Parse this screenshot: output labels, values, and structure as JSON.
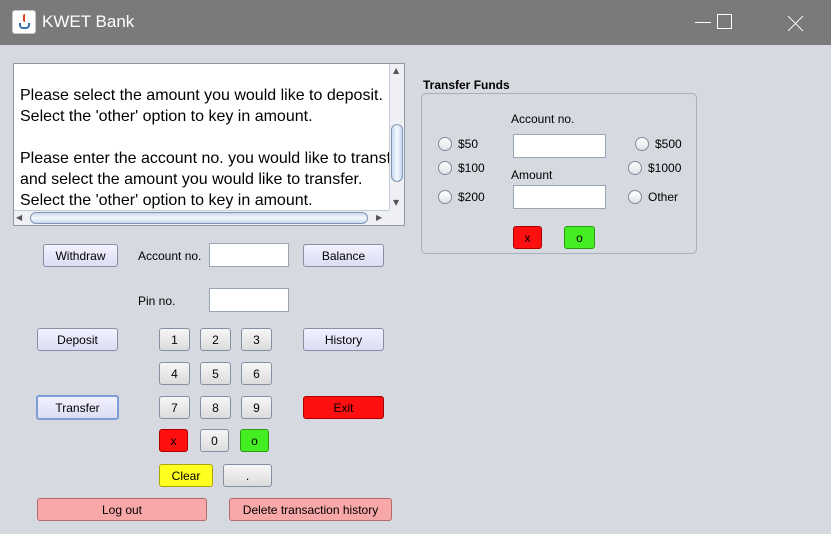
{
  "window": {
    "title": "KWET Bank"
  },
  "display": {
    "text": "Please select the amount you would like to deposit.\nSelect the 'other' option to key in amount.\n\nPlease enter the account no. you would like to transfer\nand select the amount you would like to transfer.\nSelect the 'other' option to key in amount."
  },
  "main": {
    "withdraw": "Withdraw",
    "deposit": "Deposit",
    "transfer": "Transfer",
    "balance": "Balance",
    "history": "History",
    "exit": "Exit",
    "account_label": "Account no.",
    "account_value": "",
    "pin_label": "Pin no.",
    "pin_value": "",
    "logout": "Log out",
    "delete_history": "Delete transaction history"
  },
  "keypad": {
    "keys": [
      "1",
      "2",
      "3",
      "4",
      "5",
      "6",
      "7",
      "8",
      "9",
      "x",
      "0",
      "o",
      "Clear",
      "."
    ]
  },
  "transfer_panel": {
    "title": "Transfer Funds",
    "account_label": "Account no.",
    "account_value": "",
    "amount_label": "Amount",
    "amount_value": "",
    "radios": [
      "$50",
      "$100",
      "$200",
      "$500",
      "$1000",
      "Other"
    ],
    "cancel": "x",
    "ok": "o"
  }
}
